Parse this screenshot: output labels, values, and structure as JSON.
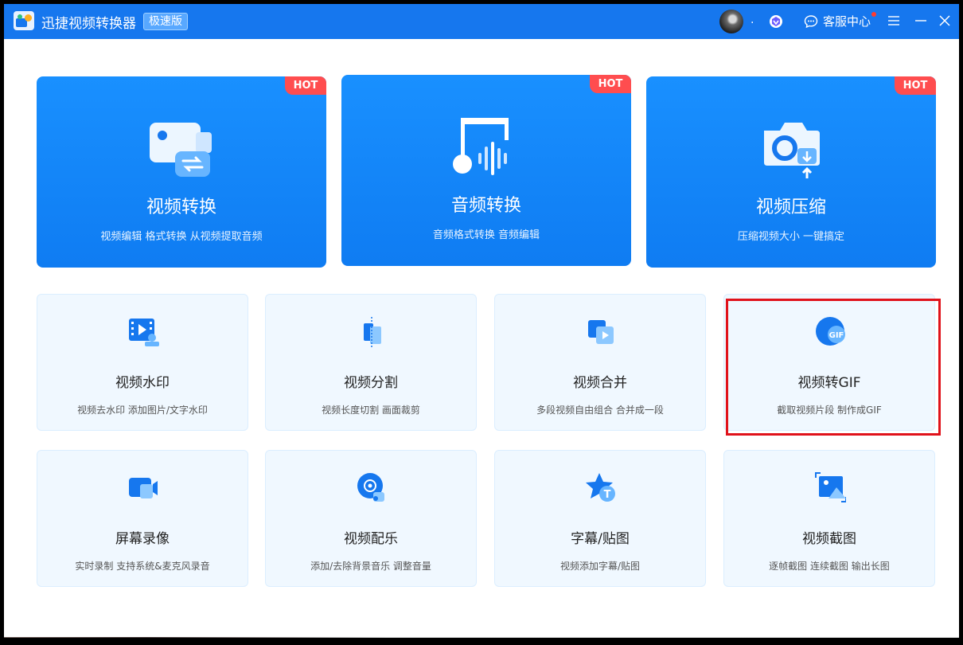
{
  "titlebar": {
    "app_title": "迅捷视频转换器",
    "edition": "极速版",
    "user_name": ".",
    "service_label": "客服中心"
  },
  "colors": {
    "brand_blue": "#1677ee",
    "hot_red": "#ff4d4f",
    "card_bg": "#f0f8ff",
    "highlight_red": "#e0121b"
  },
  "big_cards": [
    {
      "title": "视频转换",
      "desc": "视频编辑 格式转换 从视频提取音频",
      "badge": "HOT",
      "icon": "video-convert-icon"
    },
    {
      "title": "音频转换",
      "desc": "音频格式转换 音频编辑",
      "badge": "HOT",
      "icon": "audio-convert-icon"
    },
    {
      "title": "视频压缩",
      "desc": "压缩视频大小 一键搞定",
      "badge": "HOT",
      "icon": "video-compress-icon"
    }
  ],
  "tools": [
    {
      "title": "视频水印",
      "desc": "视频去水印 添加图片/文字水印",
      "icon": "watermark-icon"
    },
    {
      "title": "视频分割",
      "desc": "视频长度切割 画面裁剪",
      "icon": "split-icon"
    },
    {
      "title": "视频合并",
      "desc": "多段视频自由组合 合并成一段",
      "icon": "merge-icon"
    },
    {
      "title": "视频转GIF",
      "desc": "截取视频片段 制作成GIF",
      "icon": "gif-icon",
      "icon_text": "GIF"
    },
    {
      "title": "屏幕录像",
      "desc": "实时录制 支持系统&麦克风录音",
      "icon": "screen-record-icon"
    },
    {
      "title": "视频配乐",
      "desc": "添加/去除背景音乐 调整音量",
      "icon": "music-icon"
    },
    {
      "title": "字幕/贴图",
      "desc": "视频添加字幕/贴图",
      "icon": "subtitle-icon",
      "icon_text": "T"
    },
    {
      "title": "视频截图",
      "desc": "逐帧截图 连续截图 输出长图",
      "icon": "screenshot-icon"
    }
  ]
}
